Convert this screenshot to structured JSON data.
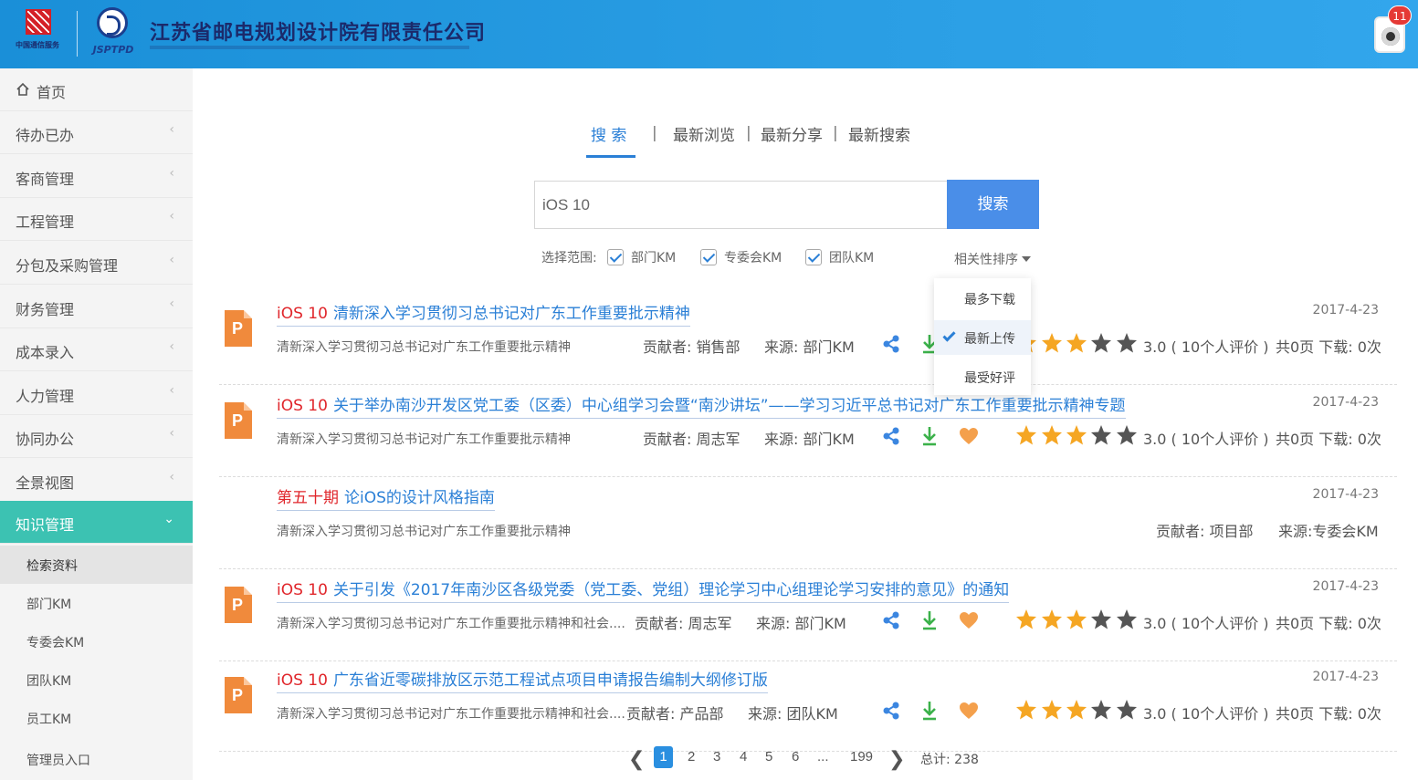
{
  "header": {
    "logo1_caption": "中国通信服务",
    "logo2_text": "JSPTPD",
    "company": "江苏省邮电规划设计院有限责任公司",
    "notification_count": "11"
  },
  "sidebar": {
    "home": "首页",
    "items": [
      {
        "label": "待办已办"
      },
      {
        "label": "客商管理"
      },
      {
        "label": "工程管理"
      },
      {
        "label": "分包及采购管理"
      },
      {
        "label": "财务管理"
      },
      {
        "label": "成本录入"
      },
      {
        "label": "人力管理"
      },
      {
        "label": "协同办公"
      },
      {
        "label": "全景视图"
      },
      {
        "label": "知识管理"
      }
    ],
    "subitems": [
      {
        "label": "检索资料"
      },
      {
        "label": "部门KM"
      },
      {
        "label": "专委会KM"
      },
      {
        "label": "团队KM"
      },
      {
        "label": "员工KM"
      },
      {
        "label": "管理员入口"
      }
    ]
  },
  "tabs": [
    {
      "label": "搜 索"
    },
    {
      "label": "最新浏览"
    },
    {
      "label": "最新分享"
    },
    {
      "label": "最新搜索"
    }
  ],
  "tab_separator": "|",
  "search": {
    "value": "iOS 10",
    "button": "搜索"
  },
  "filters": {
    "scope_label": "选择范围:",
    "options": [
      "部门KM",
      "专委会KM",
      "团队KM"
    ],
    "sort_label": "相关性排序",
    "sort_options": [
      "最多下载",
      "最新上传",
      "最受好评"
    ],
    "sort_selected": "最新上传"
  },
  "results": [
    {
      "keyword": "iOS 10",
      "title": "清新深入学习贯彻习总书记对广东工作重要批示精神",
      "date": "2017-4-23",
      "desc": "清新深入学习贯彻习总书记对广东工作重要批示精神",
      "contributor": "贡献者: 销售部",
      "source": "来源:  部门KM",
      "rating": "3.0 ( 10个人评价 )",
      "pages": "共0页  下载: 0次",
      "stars": 3
    },
    {
      "keyword": "iOS 10",
      "title": "关于举办南沙开发区党工委（区委）中心组学习会暨“南沙讲坛”——学习习近平总书记对广东工作重要批示精神专题",
      "date": "2017-4-23",
      "desc": "清新深入学习贯彻习总书记对广东工作重要批示精神",
      "contributor": "贡献者: 周志军",
      "source": "来源:  部门KM",
      "rating": "3.0 ( 10个人评价 )",
      "pages": "共0页  下载: 0次",
      "stars": 3
    },
    {
      "keyword": "第五十期",
      "title": "论iOS的设计风格指南",
      "date": "2017-4-23",
      "desc": "清新深入学习贯彻习总书记对广东工作重要批示精神",
      "contributor": "贡献者: 项目部",
      "source": "来源:专委会KM"
    },
    {
      "keyword": "iOS 10",
      "title": "关于引发《2017年南沙区各级党委（党工委、党组）理论学习中心组理论学习安排的意见》的通知",
      "date": "2017-4-23",
      "desc": "清新深入学习贯彻习总书记对广东工作重要批示精神和社会....",
      "contributor": "贡献者: 周志军",
      "source": "来源:  部门KM",
      "rating": "3.0 ( 10个人评价 )",
      "pages": "共0页  下载: 0次",
      "stars": 3
    },
    {
      "keyword": "iOS 10",
      "title": "广东省近零碳排放区示范工程试点项目申请报告编制大纲修订版",
      "date": "2017-4-23",
      "desc": "清新深入学习贯彻习总书记对广东工作重要批示精神和社会....",
      "contributor": "贡献者: 产品部",
      "source": "来源:  团队KM",
      "rating": "3.0 ( 10个人评价 )",
      "pages": "共0页  下载: 0次",
      "stars": 3
    }
  ],
  "file_icon_letter": "P",
  "pagination": {
    "pages": [
      "1",
      "2",
      "3",
      "4",
      "5",
      "6",
      "...",
      "199"
    ],
    "current": "1",
    "total": "总计:  238"
  },
  "colors": {
    "accent": "#2a7fd6",
    "sidebar_active": "#3cc2b2",
    "keyword": "#e0262b",
    "star_on": "#f5a623",
    "star_off": "#555555",
    "download": "#3bb14a",
    "heart": "#f4a04c"
  }
}
